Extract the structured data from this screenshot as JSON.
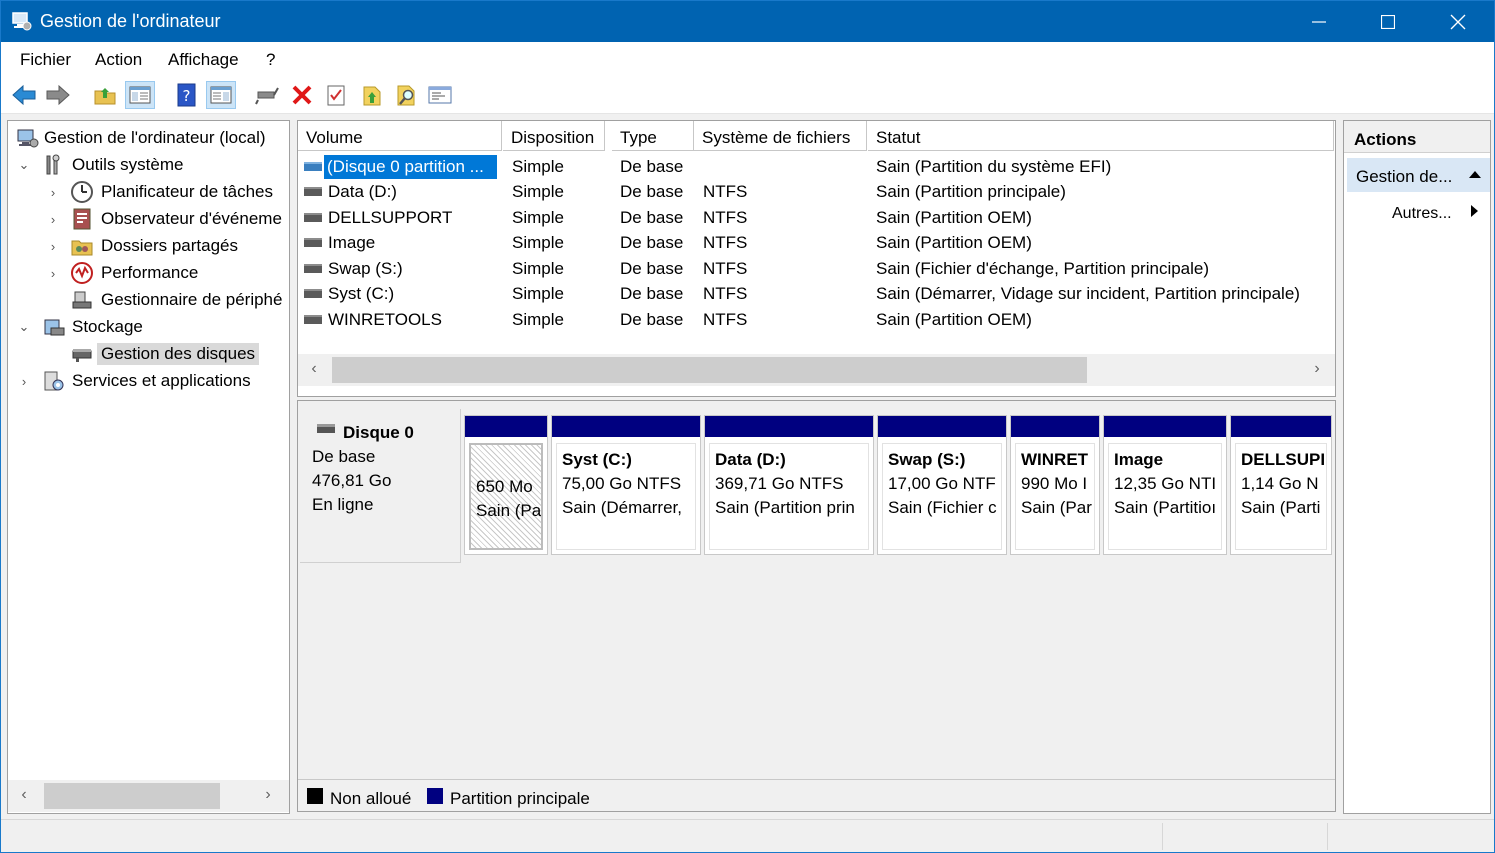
{
  "window": {
    "title": "Gestion de l'ordinateur"
  },
  "menu": [
    "Fichier",
    "Action",
    "Affichage",
    "?"
  ],
  "toolbar": [
    "back-icon",
    "forward-icon",
    "up-folder-icon",
    "show-hide-tree-icon",
    "help-icon",
    "show-hide-action-icon",
    "connect-icon",
    "delete-icon",
    "properties-icon",
    "export-icon",
    "search-icon",
    "console-icon"
  ],
  "tree": {
    "root": "Gestion de l'ordinateur (local)",
    "system_tools": "Outils système",
    "task_scheduler": "Planificateur de tâches",
    "event_viewer": "Observateur d'événeme",
    "shared_folders": "Dossiers partagés",
    "performance": "Performance",
    "device_manager": "Gestionnaire de périphé",
    "storage": "Stockage",
    "disk_management": "Gestion des disques",
    "services": "Services et applications"
  },
  "columns": [
    "Volume",
    "Disposition",
    "Type",
    "Système de fichiers",
    "Statut"
  ],
  "volumes": [
    {
      "name": "(Disque 0 partition ...",
      "layout": "Simple",
      "type": "De base",
      "fs": "",
      "status": "Sain (Partition du système EFI)"
    },
    {
      "name": "Data (D:)",
      "layout": "Simple",
      "type": "De base",
      "fs": "NTFS",
      "status": "Sain (Partition principale)"
    },
    {
      "name": "DELLSUPPORT",
      "layout": "Simple",
      "type": "De base",
      "fs": "NTFS",
      "status": "Sain (Partition OEM)"
    },
    {
      "name": "Image",
      "layout": "Simple",
      "type": "De base",
      "fs": "NTFS",
      "status": "Sain (Partition OEM)"
    },
    {
      "name": "Swap (S:)",
      "layout": "Simple",
      "type": "De base",
      "fs": "NTFS",
      "status": "Sain (Fichier d'échange, Partition principale)"
    },
    {
      "name": "Syst (C:)",
      "layout": "Simple",
      "type": "De base",
      "fs": "NTFS",
      "status": "Sain (Démarrer, Vidage sur incident, Partition principale)"
    },
    {
      "name": "WINRETOOLS",
      "layout": "Simple",
      "type": "De base",
      "fs": "NTFS",
      "status": "Sain (Partition OEM)"
    }
  ],
  "disk": {
    "name": "Disque 0",
    "type": "De base",
    "size": "476,81 Go",
    "state": "En ligne"
  },
  "partitions": [
    {
      "name": "",
      "size": "650 Mo",
      "status": "Sain (Pa"
    },
    {
      "name": "Syst  (C:)",
      "size": "75,00 Go NTFS",
      "status": "Sain (Démarrer,"
    },
    {
      "name": "Data  (D:)",
      "size": "369,71 Go NTFS",
      "status": "Sain (Partition prin"
    },
    {
      "name": "Swap  (S:)",
      "size": "17,00 Go NTF",
      "status": "Sain (Fichier c"
    },
    {
      "name": "WINRET",
      "size": "990 Mo I",
      "status": "Sain (Par"
    },
    {
      "name": "Image",
      "size": "12,35 Go NTI",
      "status": "Sain (Partitioı"
    },
    {
      "name": "DELLSUPI",
      "size": "1,14 Go N",
      "status": "Sain (Parti"
    }
  ],
  "legend": {
    "unallocated": "Non alloué",
    "primary": "Partition principale"
  },
  "colors": {
    "title_bar": "#0063b1",
    "primary_partition": "#000080",
    "unallocated": "#000000",
    "selection": "#0078d7"
  },
  "actions": {
    "header": "Actions",
    "section": "Gestion de...",
    "more": "Autres..."
  }
}
